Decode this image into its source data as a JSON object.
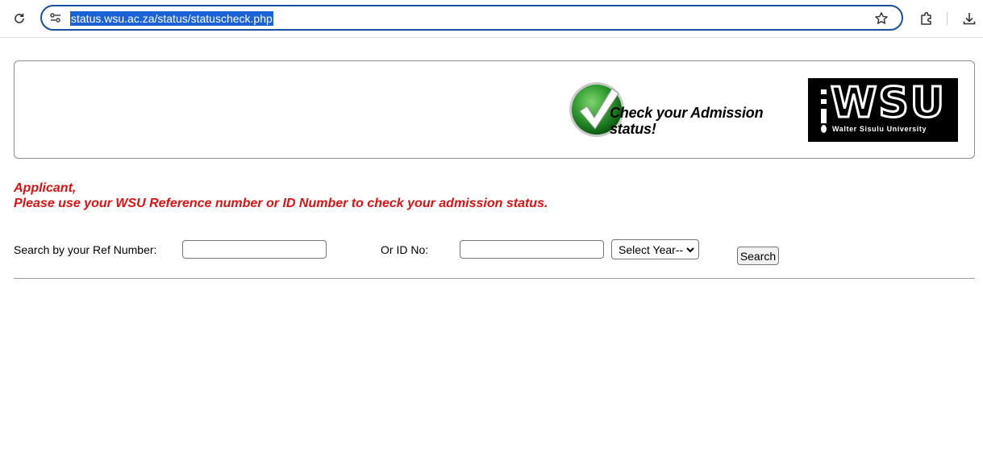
{
  "browser": {
    "url": "status.wsu.ac.za/status/statuscheck.php",
    "icons": [
      "reload-icon",
      "site-info-icon",
      "bookmark-star-icon",
      "extensions-icon",
      "download-icon"
    ]
  },
  "banner": {
    "check_line1": "Check your Admission",
    "check_line2": "status!",
    "logo_text": "WSU",
    "logo_subtext": "Walter Sisulu University"
  },
  "notice": {
    "line1": "Applicant,",
    "line2": "Please use your WSU Reference number or ID Number to check your admission status."
  },
  "form": {
    "ref_label": "Search by your Ref Number:",
    "ref_value": "",
    "id_label": "Or ID No:",
    "id_value": "",
    "year_select": "Select Year--",
    "search_button": "Search"
  },
  "colors": {
    "notice_red": "#dd1111",
    "url_highlight": "#1b62d6",
    "omnibox_border": "#1a4fa0",
    "check_green": "#2e9a2e"
  }
}
